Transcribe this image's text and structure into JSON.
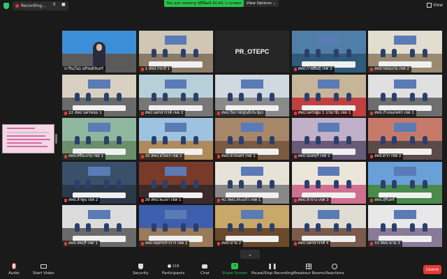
{
  "topbar": {
    "recording_label": "Recording...",
    "pause_glyph": "II",
    "stop_glyph": "■",
    "share_banner": "You are viewing ชุติพัฒน์ สป.ศธ.'s screen",
    "view_options": "View Options ⌄",
    "view_label": "View"
  },
  "gallery": {
    "tiles": [
      {
        "label": "บาริน(ไม่) อภิรมย์จันทร์",
        "wall": "#3c8fd6",
        "floor": "#5a5a5a",
        "active": true,
        "mic": false,
        "kind": "presenter"
      },
      {
        "label": "1 สพป.กระบี่ 1",
        "wall": "#cfc6b4",
        "floor": "#8a7a66",
        "mic": true
      },
      {
        "label": "PR_OTEPC",
        "text_only": true,
        "mic": false
      },
      {
        "label": "สพป.กาฬสินธุ์ เขต 2",
        "wall": "#4f7fa8",
        "floor": "#2f5a7a",
        "mic": true
      },
      {
        "label": "สพป.ขอนแก่น เขต 2",
        "wall": "#e3ddd0",
        "floor": "#9a8a70",
        "mic": true
      },
      {
        "label": "22 สพป.นครพนม 1",
        "wall": "#d8d0c0",
        "floor": "#6a6a6a",
        "mic": true
      },
      {
        "label": "สพป.นครสวรรค์ เขต 2",
        "wall": "#b7cfd8",
        "floor": "#777",
        "mic": true
      },
      {
        "label": "สพป.บึงกาฬ(ศูนย์ประชุม)",
        "wall": "#d0d8e0",
        "floor": "#8a8a8a",
        "mic": true
      },
      {
        "label": "สพป.นครปฐม 1 (เรมานิ) เขต 1",
        "wall": "#c7b59a",
        "floor": "#c04040",
        "mic": true
      },
      {
        "label": "สพป.กำแพงเพชร เขต 1",
        "wall": "#e0e0e0",
        "floor": "#6e6e6e",
        "mic": true
      },
      {
        "label": "สพป.ศรีสะเกษ เขต 1",
        "wall": "#8fb7a0",
        "floor": "#6b8f6b",
        "mic": true
      },
      {
        "label": "35 สพป.ยโสธร เขต 2",
        "wall": "#9ec3e0",
        "floor": "#b08a5a",
        "mic": true
      },
      {
        "label": "สพป.สกลนคร เขต 1",
        "wall": "#a8866a",
        "floor": "#7a5a40",
        "mic": true
      },
      {
        "label": "สพป.นนทบุรี เขต 2",
        "wall": "#c0b0c8",
        "floor": "#6a5a7a",
        "mic": true
      },
      {
        "label": "สพป.ตาก เขต 2",
        "wall": "#c87a6a",
        "floor": "#5a4a4a",
        "mic": true
      },
      {
        "label": "สพป.ลำพูน เขต 2",
        "wall": "#3a4f6a",
        "floor": "#2a3a4a",
        "mic": true
      },
      {
        "label": "39 สพป.พะเยา เขต 1",
        "wall": "#7a3a2a",
        "floor": "#3a2a2a",
        "mic": true
      },
      {
        "label": "41 สพป.สระแก้ว เขต 1",
        "wall": "#e6e2d8",
        "floor": "#888",
        "mic": true
      },
      {
        "label": "สพป.ลำปาง เขต 3",
        "wall": "#ece6da",
        "floor": "#d07090",
        "mic": true
      },
      {
        "label": "สพป.สุรินทร์",
        "wall": "#6aa0d8",
        "floor": "#4a8a4a",
        "mic": true
      },
      {
        "label": "สพป.ลพบุรี เขต 1",
        "wall": "#dcdcdc",
        "floor": "#6a6a6a",
        "mic": true
      },
      {
        "label": "สพป.สมุทรปราการ เขต 2",
        "wall": "#3e5fae",
        "floor": "#9a7a5a",
        "mic": true
      },
      {
        "label": "สพป.น่าน 2",
        "wall": "#c9a86a",
        "floor": "#6a4a2a",
        "mic": true
      },
      {
        "label": "สพป.นครสวรรค์ 4",
        "wall": "#e0dcd4",
        "floor": "#7a5a4a",
        "mic": true
      },
      {
        "label": "33 สพป.น่าน 3",
        "wall": "#e8e8e8",
        "floor": "#8a7a9a",
        "mic": true
      }
    ]
  },
  "scroll_glyph": "⌄",
  "toolbar": {
    "audio": "Audio",
    "start_video": "Start Video",
    "security": "Security",
    "participants": "Participants",
    "participants_count": "118",
    "chat": "Chat",
    "share_screen": "Share Screen",
    "pause_recording": "Pause/Stop Recording",
    "breakout_rooms": "Breakout Rooms",
    "reactions": "Reactions",
    "leave": "Leave"
  },
  "colors": {
    "accent_green": "#27c24c",
    "leave_red": "#e53935",
    "active_speaker": "#8ee34f"
  }
}
